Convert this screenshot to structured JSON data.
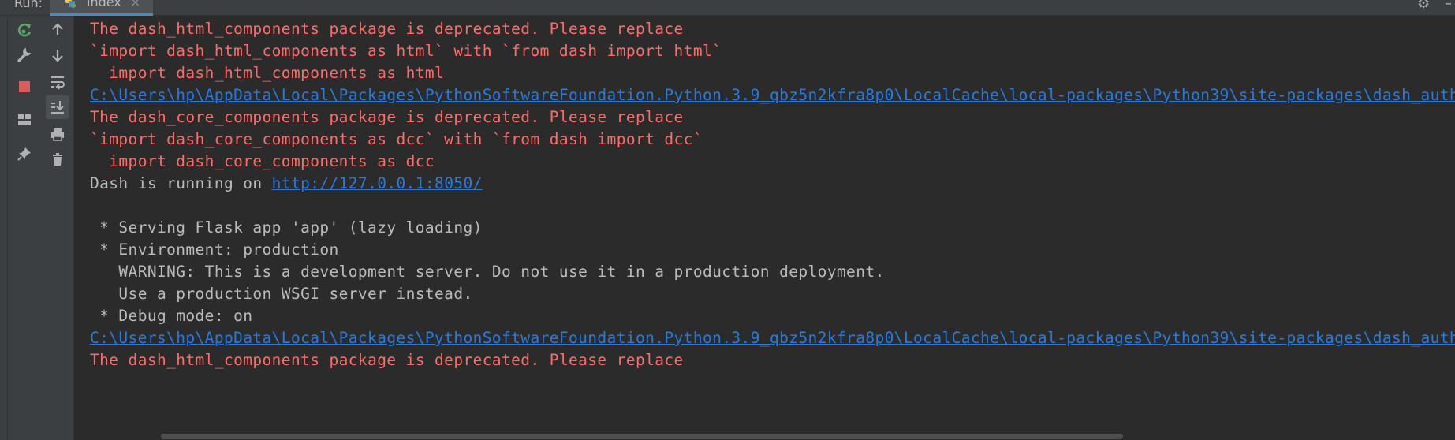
{
  "run_bar": {
    "label": "Run:",
    "tab_name": "index",
    "tab_close": "×"
  },
  "toolbar": {
    "rerun_icon": "rerun-icon",
    "settings_icon": "wrench-icon",
    "stop_icon": "stop-icon",
    "layout_icon": "layout-icon",
    "pin_icon": "pin-icon",
    "up_icon": "arrow-up-icon",
    "down_icon": "arrow-down-icon",
    "wrap_icon": "soft-wrap-icon",
    "scroll_end_icon": "scroll-to-end-icon",
    "print_icon": "print-icon",
    "trash_icon": "trash-icon"
  },
  "colors": {
    "error": "#ff6b68",
    "text": "#bbbbbb",
    "link": "#287bde",
    "background": "#2b2b2b"
  },
  "console": {
    "lines": [
      {
        "type": "err",
        "text": "The dash_html_components package is deprecated. Please replace"
      },
      {
        "type": "err",
        "text": "`import dash_html_components as html` with `from dash import html`"
      },
      {
        "type": "err",
        "text": "  import dash_html_components as html"
      },
      {
        "type": "lnk",
        "text": "C:\\Users\\hp\\AppData\\Local\\Packages\\PythonSoftwareFoundation.Python.3.9_qbz5n2kfra8p0\\LocalCache\\local-packages\\Python39\\site-packages\\dash_auth\\p"
      },
      {
        "type": "err",
        "text": "The dash_core_components package is deprecated. Please replace"
      },
      {
        "type": "err",
        "text": "`import dash_core_components as dcc` with `from dash import dcc`"
      },
      {
        "type": "err",
        "text": "  import dash_core_components as dcc"
      },
      {
        "type": "txt",
        "text": "Dash is running on ",
        "link": "http://127.0.0.1:8050/"
      },
      {
        "type": "txt",
        "text": ""
      },
      {
        "type": "txt",
        "text": " * Serving Flask app 'app' (lazy loading)"
      },
      {
        "type": "txt",
        "text": " * Environment: production"
      },
      {
        "type": "txt",
        "text": "   WARNING: This is a development server. Do not use it in a production deployment."
      },
      {
        "type": "txt",
        "text": "   Use a production WSGI server instead."
      },
      {
        "type": "txt",
        "text": " * Debug mode: on"
      },
      {
        "type": "lnk",
        "text": "C:\\Users\\hp\\AppData\\Local\\Packages\\PythonSoftwareFoundation.Python.3.9_qbz5n2kfra8p0\\LocalCache\\local-packages\\Python39\\site-packages\\dash_auth\\p"
      },
      {
        "type": "err",
        "text": "The dash_html_components package is deprecated. Please replace"
      }
    ]
  }
}
